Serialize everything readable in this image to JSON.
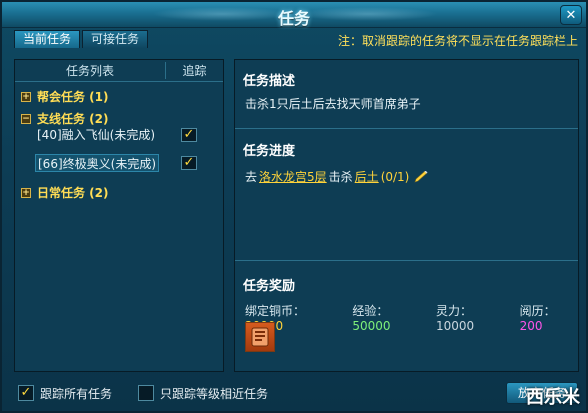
{
  "window": {
    "title": "任务"
  },
  "tabs": [
    {
      "label": "当前任务",
      "active": true
    },
    {
      "label": "可接任务",
      "active": false
    }
  ],
  "notice": "注：取消跟踪的任务将不显示在任务跟踪栏上",
  "task_list": {
    "header_list": "任务列表",
    "header_track": "追踪",
    "categories": [
      {
        "label": "帮会任务 (1)",
        "expanded": false
      },
      {
        "label": "支线任务 (2)",
        "expanded": true
      },
      {
        "label": "日常任务 (2)",
        "expanded": false
      }
    ],
    "tasks": [
      {
        "label": "[40]融入飞仙(未完成)",
        "tracked": true
      },
      {
        "label": "[66]终极奥义(未完成)",
        "tracked": true,
        "selected": true
      }
    ]
  },
  "detail": {
    "desc_title": "任务描述",
    "desc_text": "击杀1只后土后去找天师首席弟子",
    "progress_title": "任务进度",
    "progress": {
      "prefix": "去",
      "place": "洛水龙宫5层",
      "mid": "击杀",
      "target": "后土",
      "count": "(0/1)"
    },
    "reward_title": "任务奖励",
    "rewards": [
      {
        "label": "绑定铜币：",
        "value": "20000"
      },
      {
        "label": "经验：",
        "value": "50000"
      },
      {
        "label": "灵力：",
        "value": "10000"
      },
      {
        "label": "阅历：",
        "value": "200"
      }
    ]
  },
  "bottom": {
    "track_all_label": "跟踪所有任务",
    "track_all_checked": true,
    "track_level_label": "只跟踪等级相近任务",
    "track_level_checked": false,
    "abandon_label": "放弃任务"
  },
  "watermark": "西乐米",
  "colors": {
    "accent": "#ffd33a",
    "exp": "#7ef07a",
    "yueli": "#ff55e8",
    "panel": "#0e3d54"
  }
}
